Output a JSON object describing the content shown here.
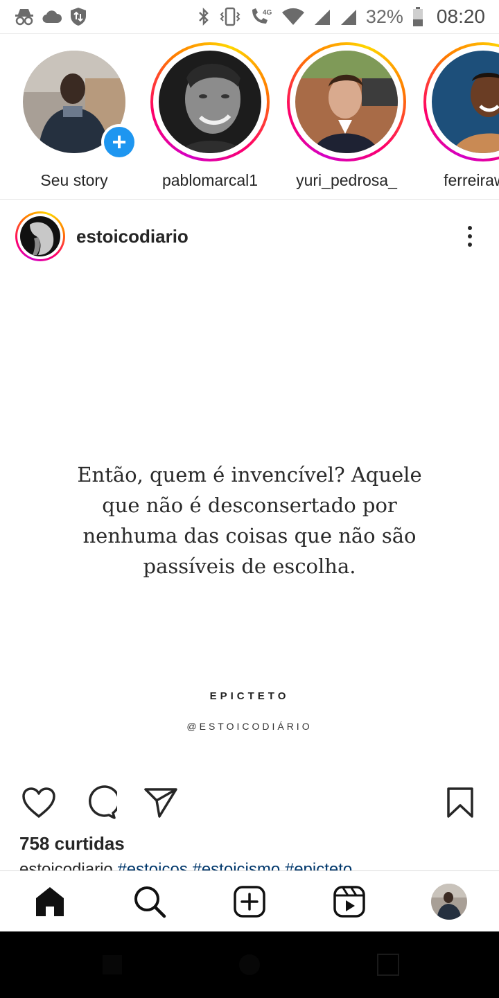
{
  "status_bar": {
    "battery": "32%",
    "time": "08:20",
    "network_label": "4G",
    "icons": [
      "incognito-icon",
      "cloud-icon",
      "shield-sync-icon",
      "bluetooth-icon",
      "vibrate-icon",
      "volte-call-icon",
      "wifi-icon",
      "signal-icon",
      "signal-icon",
      "battery-icon"
    ]
  },
  "stories": [
    {
      "username": "Seu story",
      "own": true,
      "active": false
    },
    {
      "username": "pablomarcal1",
      "own": false,
      "active": true
    },
    {
      "username": "yuri_pedrosa_",
      "own": false,
      "active": true
    },
    {
      "username": "ferreirawas",
      "own": false,
      "active": true
    }
  ],
  "post": {
    "username": "estoicodiario",
    "quote": "Então, quem é invencível? Aquele que não é desconsertado por nenhuma das coisas que não são passíveis de escolha.",
    "author": "EPICTETO",
    "handle": "@ESTOICODIÁRIO",
    "likes": "758 curtidas",
    "caption_user": "estoicodiario",
    "caption_tags": "#estoicos #estoicismo #epicteto"
  },
  "colors": {
    "accent_blue": "#1e96f0",
    "text": "#262626",
    "link": "#00376b"
  },
  "bottom_nav": [
    "home-icon",
    "search-icon",
    "new-post-icon",
    "reels-icon",
    "profile-avatar"
  ]
}
